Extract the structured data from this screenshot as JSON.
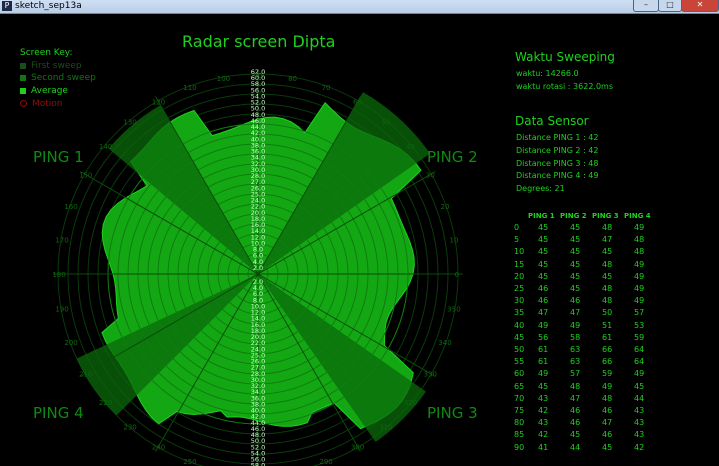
{
  "window": {
    "title": "sketch_sep13a",
    "icon_letter": "P"
  },
  "key": {
    "title": "Screen Key:",
    "items": [
      {
        "label": "First sweep",
        "color": "#1b4d1b"
      },
      {
        "label": "Second sweep",
        "color": "#127512"
      },
      {
        "label": "Average",
        "color": "#1fd11f"
      },
      {
        "label": "Motion",
        "color": "#8a0f0f"
      }
    ]
  },
  "radar": {
    "title": "Radar screen Dipta",
    "ping_labels": [
      "PING 1",
      "PING 2",
      "PING 3",
      "PING 4"
    ],
    "angle_labels": [
      "0",
      "10",
      "20",
      "30",
      "40",
      "50",
      "60",
      "70",
      "80",
      "90",
      "100",
      "110",
      "120",
      "130",
      "140",
      "150",
      "160",
      "170",
      "180",
      "190",
      "200",
      "210",
      "220",
      "230",
      "240",
      "250",
      "260",
      "270",
      "280",
      "290",
      "300",
      "310",
      "320",
      "330",
      "340",
      "350"
    ],
    "scale_labels": [
      "62.0",
      "60.0",
      "58.0",
      "56.0",
      "54.0",
      "52.0",
      "50.0",
      "48.0",
      "46.0",
      "44.0",
      "42.0",
      "40.0",
      "38.0",
      "36.0",
      "34.0",
      "32.0",
      "30.0",
      "28.0",
      "27.0",
      "26.0",
      "25.0",
      "24.0",
      "22.0",
      "20.0",
      "18.0",
      "16.0",
      "14.0",
      "12.0",
      "10.0",
      "8.0",
      "6.0",
      "4.0",
      "2.0"
    ],
    "colors": {
      "fill": "#13a813",
      "fill_light": "#1fd11f",
      "grid": "#0a3a0a",
      "label": "#c8ffc8"
    }
  },
  "sweep": {
    "heading": "Waktu Sweeping",
    "time": "waktu: 14266.0",
    "rotation": "waktu rotasi : 3622.0ms"
  },
  "sensor": {
    "heading": "Data Sensor",
    "lines": [
      "Distance PING 1 : 42",
      "Distance PING 2 : 42",
      "Distance PING 3 : 48",
      "Distance PING 4 : 49",
      "Degrees: 21"
    ],
    "columns": [
      "",
      "PING 1",
      "PING 2",
      "PING 3",
      "PING 4"
    ],
    "rows": [
      [
        "0",
        "45",
        "45",
        "48",
        "49"
      ],
      [
        "5",
        "45",
        "45",
        "47",
        "48"
      ],
      [
        "10",
        "45",
        "45",
        "45",
        "48"
      ],
      [
        "15",
        "45",
        "45",
        "48",
        "49"
      ],
      [
        "20",
        "45",
        "45",
        "45",
        "49"
      ],
      [
        "25",
        "46",
        "45",
        "48",
        "49"
      ],
      [
        "30",
        "46",
        "46",
        "48",
        "49"
      ],
      [
        "35",
        "47",
        "47",
        "50",
        "57"
      ],
      [
        "40",
        "49",
        "49",
        "51",
        "53"
      ],
      [
        "45",
        "56",
        "58",
        "61",
        "59"
      ],
      [
        "50",
        "61",
        "63",
        "66",
        "64"
      ],
      [
        "55",
        "61",
        "63",
        "66",
        "64"
      ],
      [
        "60",
        "49",
        "57",
        "59",
        "49"
      ],
      [
        "65",
        "45",
        "48",
        "49",
        "45"
      ],
      [
        "70",
        "43",
        "47",
        "48",
        "44"
      ],
      [
        "75",
        "42",
        "46",
        "46",
        "43"
      ],
      [
        "80",
        "43",
        "46",
        "47",
        "43"
      ],
      [
        "85",
        "42",
        "45",
        "46",
        "43"
      ],
      [
        "90",
        "41",
        "44",
        "45",
        "42"
      ]
    ]
  }
}
